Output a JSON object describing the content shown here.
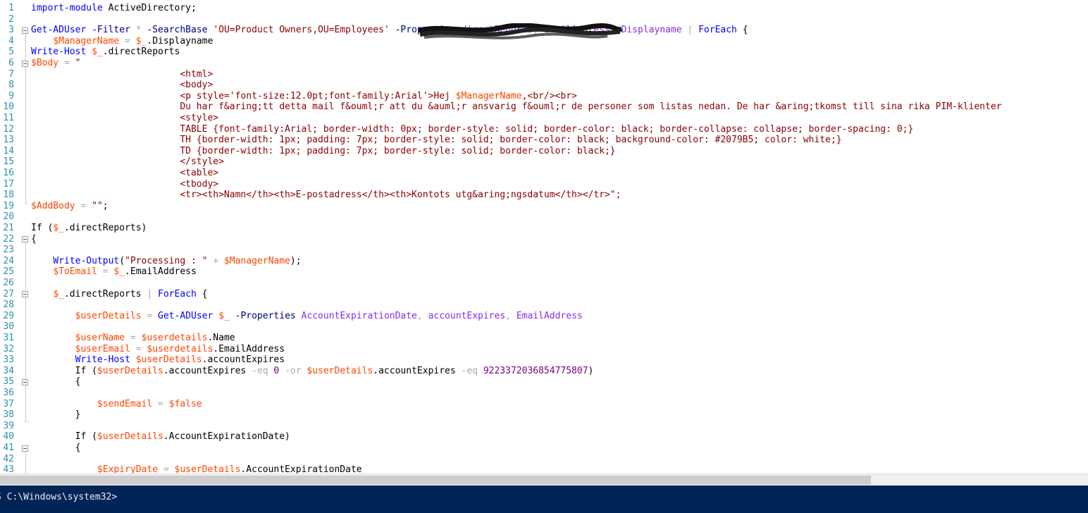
{
  "editor": {
    "line_numbers": [
      "1",
      "2",
      "3",
      "4",
      "5",
      "6",
      "7",
      "8",
      "9",
      "10",
      "11",
      "12",
      "13",
      "14",
      "15",
      "16",
      "17",
      "18",
      "19",
      "20",
      "21",
      "22",
      "23",
      "24",
      "25",
      "26",
      "27",
      "28",
      "29",
      "30",
      "31",
      "32",
      "33",
      "34",
      "35",
      "36",
      "37",
      "38",
      "39",
      "40",
      "41",
      "42",
      "43"
    ],
    "code": {
      "l1": [
        "import-module",
        " ActiveDirectory;"
      ],
      "l3": [
        "Get-ADUser",
        " -Filter ",
        "*",
        " -SearchBase ",
        "'OU=Product Owners,OU=Employees",
        "' ",
        "-Properties ",
        "directReports",
        ", ",
        "EmailAddress",
        ", ",
        "Displayname",
        " | ",
        "ForEach",
        " {"
      ],
      "l4": [
        "    ",
        "$ManagerName",
        " = ",
        "$_",
        ".Displayname"
      ],
      "l5": [
        "Write-Host",
        " ",
        "$_",
        ".directReports"
      ],
      "l6": [
        "$Body",
        " = ",
        "\""
      ],
      "l7": "                           <html>",
      "l8": "                           <body>",
      "l9": [
        "                           <p style='font-size:12.0pt;font-family:Arial'>Hej ",
        "$ManagerName",
        ",<br/><br>"
      ],
      "l10": "                           Du har f&aring;tt detta mail f&ouml;r att du &auml;r ansvarig f&ouml;r de personer som listas nedan. De har &aring;tkomst till sina rika PIM-klienter",
      "l11": "                           <style>",
      "l12": "                           TABLE {font-family:Arial; border-width: 0px; border-style: solid; border-color: black; border-collapse: collapse; border-spacing: 0;}",
      "l13": "                           TH {border-width: 1px; padding: 7px; border-style: solid; border-color: black; background-color: #2079B5; color: white;}",
      "l14": "                           TD {border-width: 1px; padding: 7px; border-style: solid; border-color: black;}",
      "l15": "                           </style>",
      "l16": "                           <table>",
      "l17": "                           <tbody>",
      "l18": "                           <tr><th>Namn</th><th>E-postadress</th><th>Kontots utg&aring;ngsdatum</th></tr>\";",
      "l19": [
        "$AddBody",
        " = ",
        "\"\"",
        ";"
      ],
      "l21": [
        "If (",
        "$_",
        ".directReports)"
      ],
      "l22": "{",
      "l24": [
        "    ",
        "Write-Output",
        "(",
        "\"Processing : \"",
        " + ",
        "$ManagerName",
        ");"
      ],
      "l25": [
        "    ",
        "$ToEmail",
        " = ",
        "$_",
        ".EmailAddress"
      ],
      "l27": [
        "    ",
        "$_",
        ".directReports",
        " | ",
        "ForEach",
        " {"
      ],
      "l29": [
        "        ",
        "$userDetails",
        " = ",
        "Get-ADUser",
        " ",
        "$_",
        " -Properties ",
        "AccountExpirationDate",
        ", ",
        "accountExpires",
        ", ",
        "EmailAddress"
      ],
      "l31": [
        "        ",
        "$userName",
        " = ",
        "$userdetails",
        ".Name"
      ],
      "l32": [
        "        ",
        "$userEmail",
        " = ",
        "$userdetails",
        ".EmailAddress"
      ],
      "l33": [
        "        ",
        "Write-Host",
        " ",
        "$userDetails",
        ".accountExpires"
      ],
      "l34": [
        "        If (",
        "$userDetails",
        ".accountExpires ",
        "-eq",
        " ",
        "0",
        " ",
        "-or",
        " ",
        "$userDetails",
        ".accountExpires ",
        "-eq",
        " ",
        "9223372036854775807",
        ")"
      ],
      "l35": "        {",
      "l37": [
        "            ",
        "$sendEmail",
        " = ",
        "$false"
      ],
      "l38": "        }",
      "l40": [
        "        If (",
        "$userDetails",
        ".AccountExpirationDate)"
      ],
      "l41": "        {",
      "l43": [
        "            ",
        "$ExpiryDate",
        " = ",
        "$userDetails",
        ".AccountExpirationDate"
      ]
    }
  },
  "console": {
    "prompt": "S C:\\Windows\\system32>"
  },
  "colors": {
    "console_bg": "#012456",
    "keyword": "#0000ff",
    "variable": "#ff4500",
    "string": "#8b0000",
    "attribute": "#8a2be2",
    "line_number": "#2b91af"
  }
}
